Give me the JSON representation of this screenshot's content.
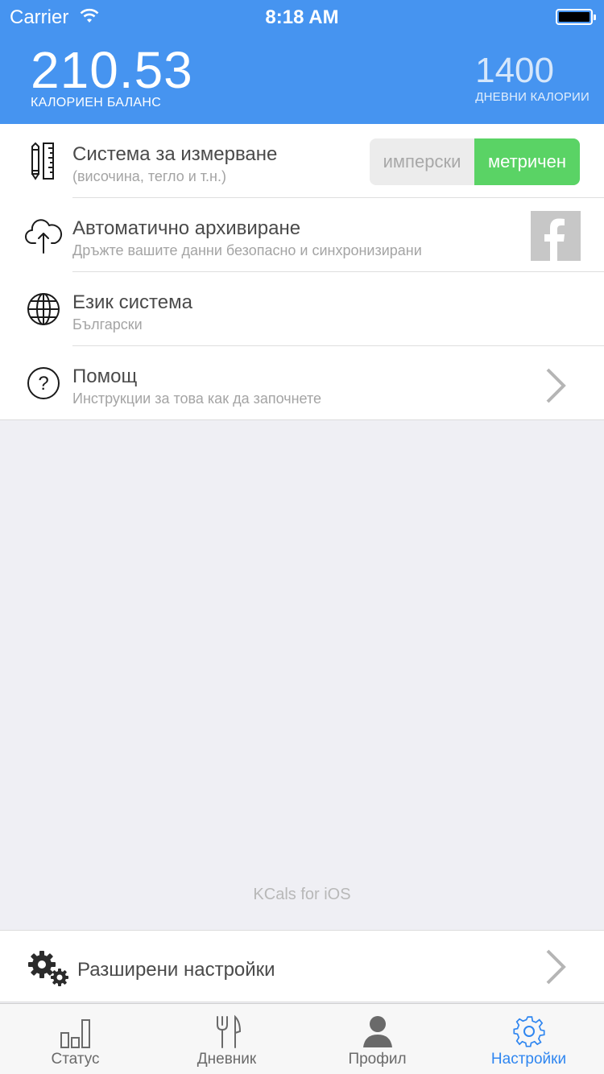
{
  "status_bar": {
    "carrier": "Carrier",
    "time": "8:18 AM"
  },
  "header": {
    "balance_value": "210.53",
    "balance_label": "КАЛОРИЕН БАЛАНС",
    "daily_value": "1400",
    "daily_label": "ДНЕВНИ КАЛОРИИ",
    "background_color": "#4694f0"
  },
  "settings": {
    "measurement": {
      "title": "Система за измерване",
      "subtitle": "(височина, тегло и т.н.)",
      "options": [
        "имперски",
        "метричен"
      ],
      "selected": "метричен",
      "selected_color": "#5ad365",
      "icon": "pencil-ruler-icon"
    },
    "backup": {
      "title": "Автоматично архивиране",
      "subtitle": "Дръжте вашите данни безопасно и синхронизирани",
      "icon": "cloud-upload-icon",
      "action_icon": "facebook-icon"
    },
    "language": {
      "title": "Език система",
      "subtitle": "Български",
      "icon": "globe-icon"
    },
    "help": {
      "title": "Помощ",
      "subtitle": "Инструкции за това как да започнете",
      "icon": "question-circle-icon"
    }
  },
  "footer_text": "KCals for iOS",
  "advanced": {
    "label": "Разширени настройки",
    "icon": "gears-icon"
  },
  "tabs": [
    {
      "label": "Статус",
      "icon": "bar-chart-icon",
      "active": false
    },
    {
      "label": "Дневник",
      "icon": "fork-knife-icon",
      "active": false
    },
    {
      "label": "Профил",
      "icon": "person-icon",
      "active": false
    },
    {
      "label": "Настройки",
      "icon": "gear-icon",
      "active": true
    }
  ],
  "colors": {
    "accent": "#2f86f0",
    "header": "#4694f0",
    "toggle_on": "#5ad365"
  }
}
